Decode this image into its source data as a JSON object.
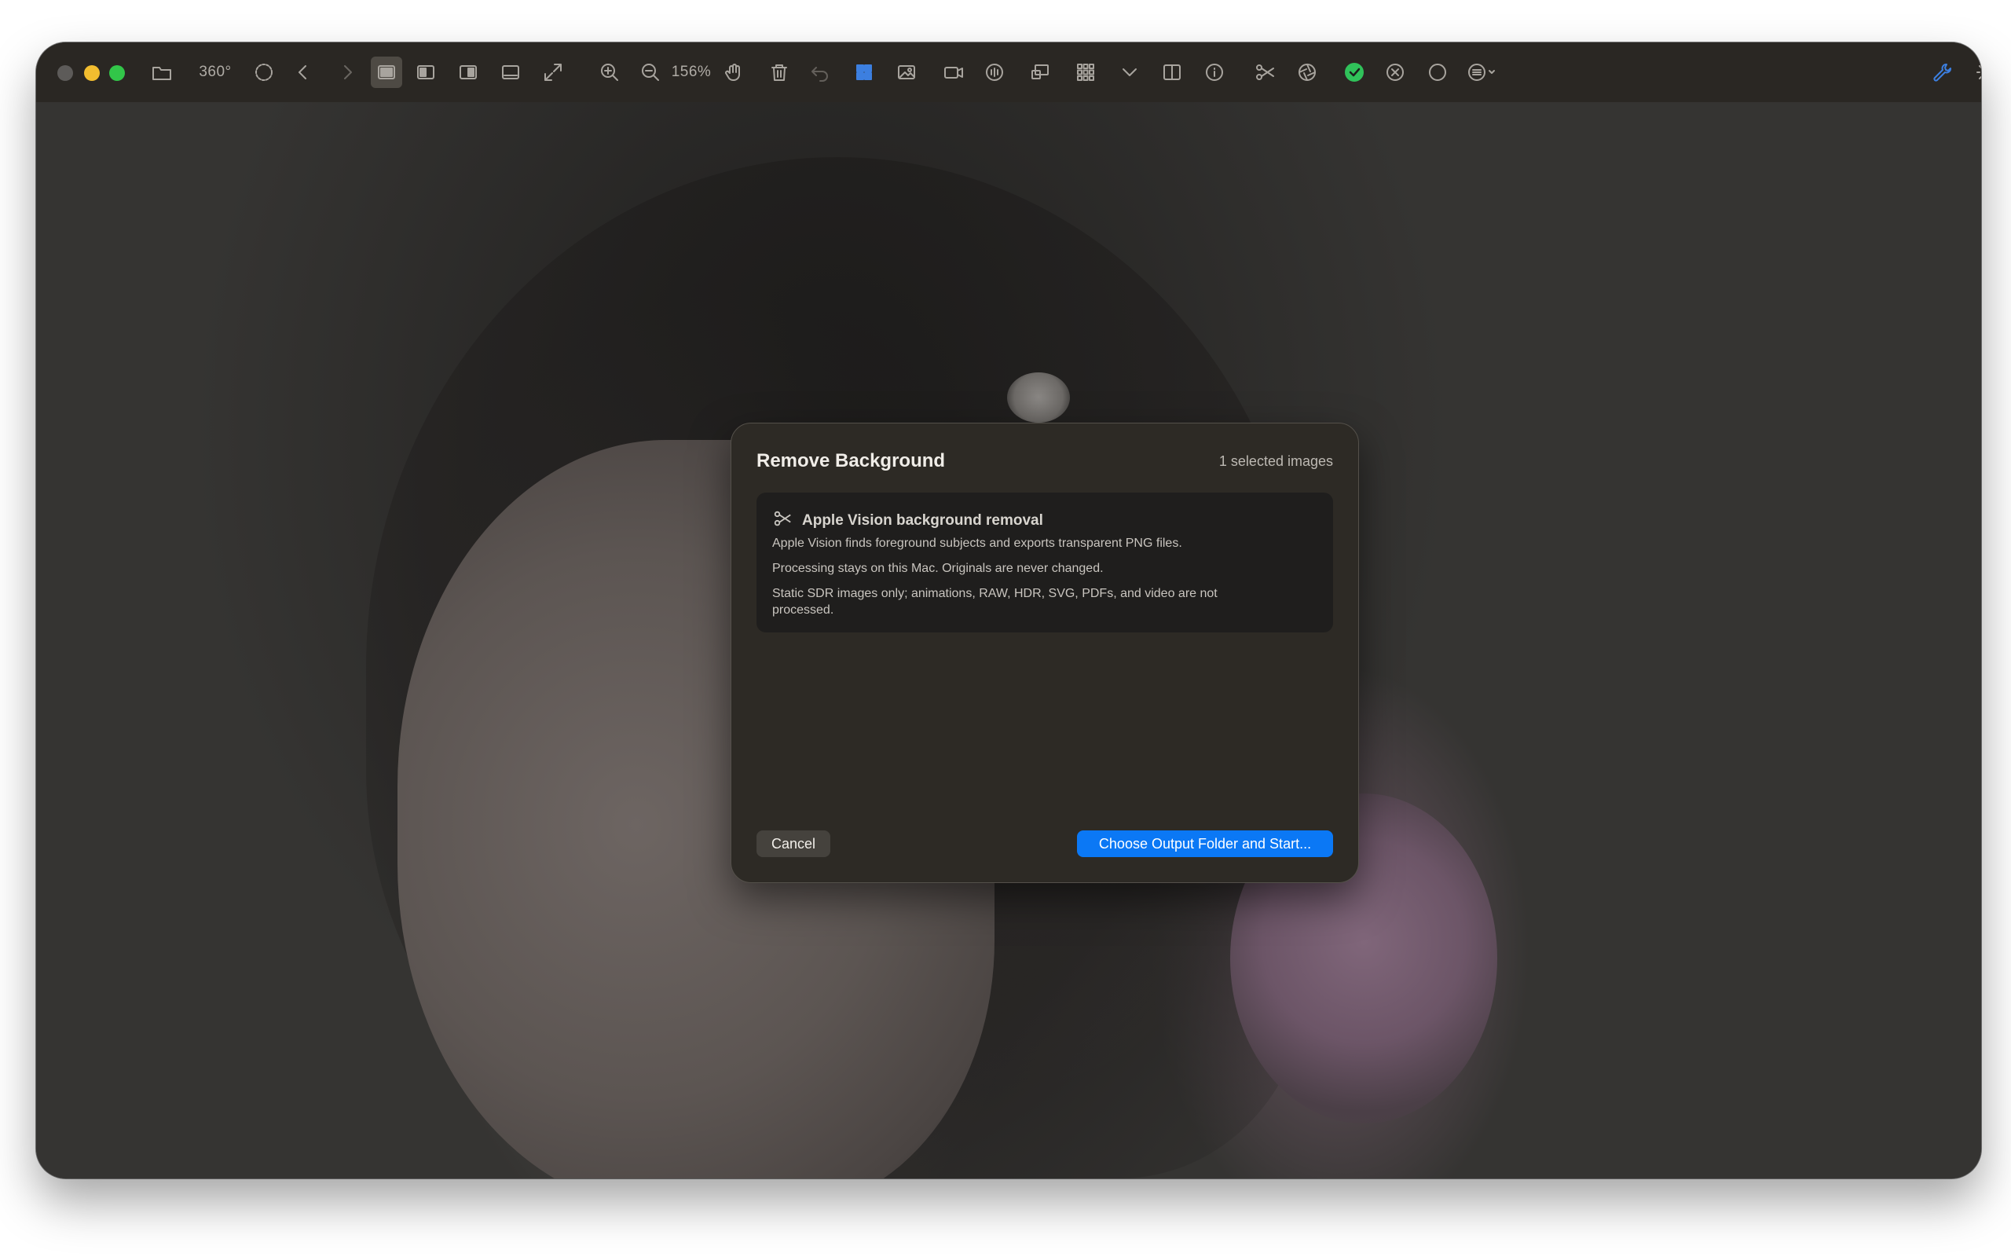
{
  "toolbar": {
    "rotation_label": "360°",
    "zoom_label": "156%",
    "icons": [
      "folder-icon",
      "circle-dashed-icon",
      "chevron-left-icon",
      "chevron-right-icon",
      "single-view-icon",
      "left-panel-icon",
      "right-panel-icon",
      "bottom-panel-icon",
      "fullscreen-icon",
      "zoom-in-icon",
      "zoom-out-icon",
      "hand-icon",
      "trash-icon",
      "undo-icon",
      "grid-icon",
      "image-icon",
      "video-icon",
      "audio-icon",
      "slideshow-icon",
      "thumbnails-icon",
      "chevron-down-icon",
      "split-view-icon",
      "info-icon",
      "scissors-icon",
      "aperture-icon",
      "check-circle-icon",
      "x-circle-icon",
      "circle-icon",
      "menu-icon",
      "wrench-icon",
      "brightness-icon"
    ]
  },
  "colors": {
    "accent": "#0B78F5",
    "check_green": "#30C25A",
    "grid_blue": "#3C7FE0"
  },
  "dialog": {
    "title": "Remove Background",
    "selection_count": "1 selected images",
    "info": {
      "heading": "Apple Vision background removal",
      "lines": [
        "Apple Vision finds foreground subjects and exports transparent PNG files.",
        "Processing stays on this Mac. Originals are never changed.",
        "Static SDR images only; animations, RAW, HDR, SVG, PDFs, and video are not processed."
      ]
    },
    "cancel_label": "Cancel",
    "primary_label": "Choose Output Folder and Start..."
  }
}
